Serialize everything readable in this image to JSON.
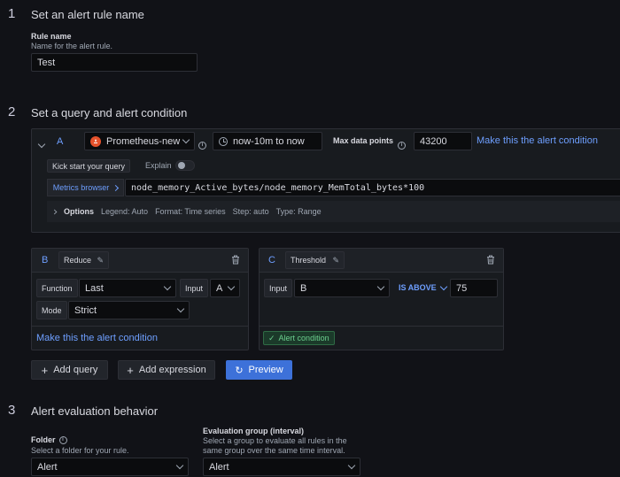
{
  "section1": {
    "number": "1",
    "title": "Set an alert rule name",
    "rule_name_label": "Rule name",
    "rule_name_desc": "Name for the alert rule.",
    "rule_name_value": "Test"
  },
  "section2": {
    "number": "2",
    "title": "Set a query and alert condition",
    "query": {
      "ref_id": "A",
      "datasource": "Prometheus-new",
      "time_range": "now-10m to now",
      "max_data_points_label": "Max data points",
      "max_data_points": "43200",
      "make_condition": "Make this the alert condition",
      "kick_start": "Kick start your query",
      "explain": "Explain",
      "metrics_browser": "Metrics browser",
      "expr": "node_memory_Active_bytes/node_memory_MemTotal_bytes*100",
      "options_label": "Options",
      "options_summary": [
        "Legend: Auto",
        "Format: Time series",
        "Step: auto",
        "Type: Range"
      ]
    },
    "expr_b": {
      "ref_id": "B",
      "type": "Reduce",
      "function_label": "Function",
      "function_value": "Last",
      "input_label": "Input",
      "input_value": "A",
      "mode_label": "Mode",
      "mode_value": "Strict",
      "make_condition": "Make this the alert condition"
    },
    "expr_c": {
      "ref_id": "C",
      "type": "Threshold",
      "input_label": "Input",
      "input_value": "B",
      "operator": "IS ABOVE",
      "threshold": "75",
      "alert_condition": "Alert condition"
    },
    "buttons": {
      "add_query": "Add query",
      "add_expression": "Add expression",
      "preview": "Preview"
    }
  },
  "section3": {
    "number": "3",
    "title": "Alert evaluation behavior",
    "folder_label": "Folder",
    "folder_desc": "Select a folder for your rule.",
    "folder_value": "Alert",
    "group_label": "Evaluation group (interval)",
    "group_desc": "Select a group to evaluate all rules in the same group over the same time interval.",
    "group_value": "Alert"
  },
  "colors": {
    "background": "#111217",
    "panel": "#181b1f",
    "link": "#6e9fff",
    "primary": "#3d71d9",
    "prometheus": "#e6522c",
    "success": "#6ccf8e"
  }
}
